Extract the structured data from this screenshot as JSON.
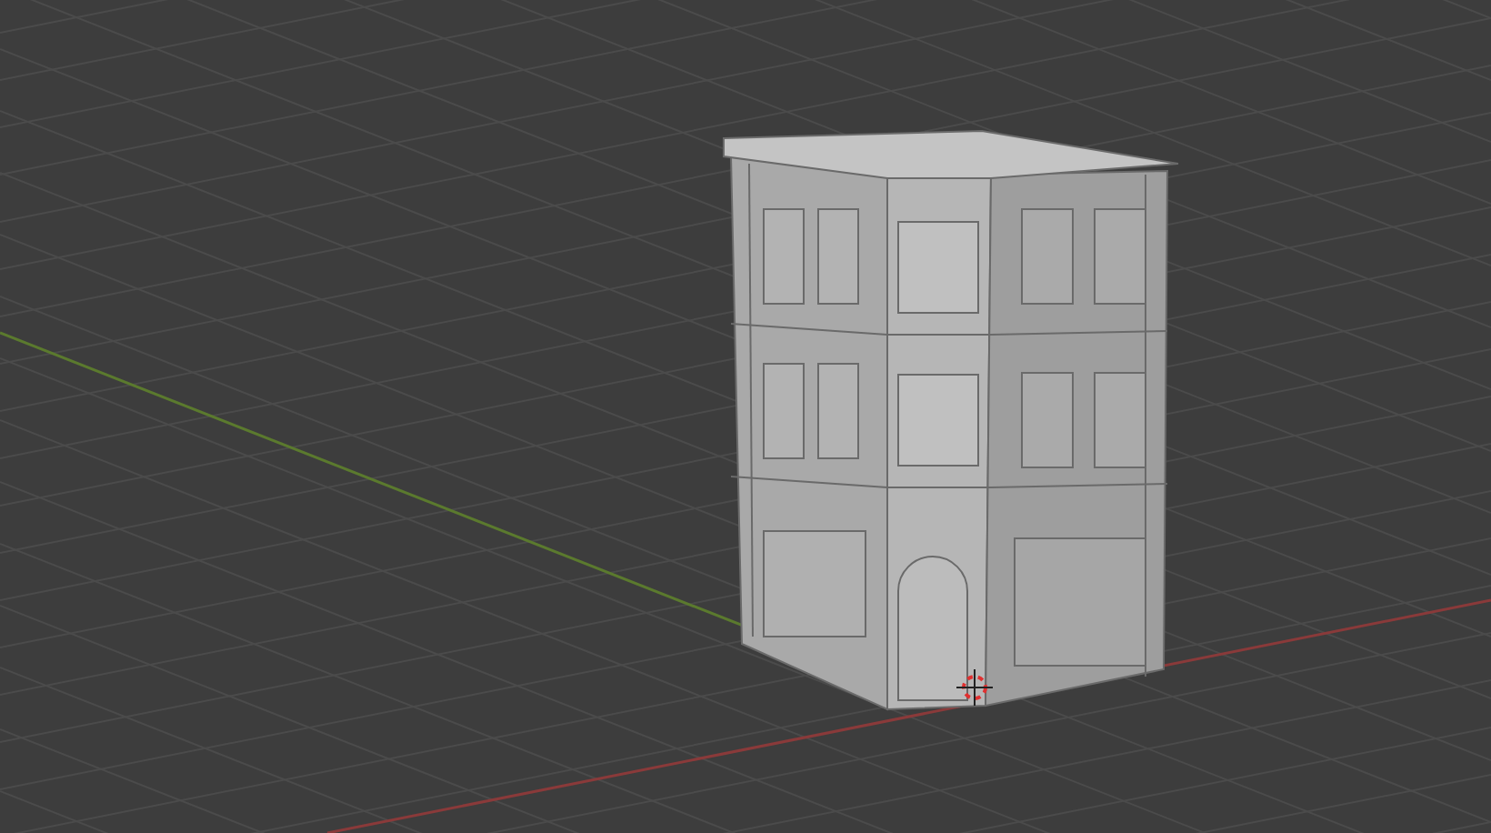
{
  "viewport": {
    "grid_floor": true,
    "axes": true,
    "cursor_3d": true
  }
}
